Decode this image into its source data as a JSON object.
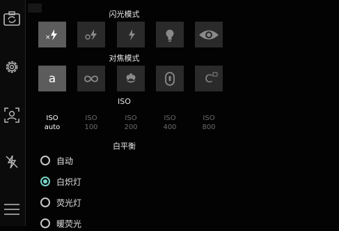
{
  "sidebar": {
    "items": [
      {
        "icon": "switch-camera-icon"
      },
      {
        "icon": "gear-icon"
      },
      {
        "icon": "face-detect-icon"
      },
      {
        "icon": "flash-off-icon"
      },
      {
        "icon": "menu-icon"
      }
    ]
  },
  "flash": {
    "title": "闪光模式",
    "options": [
      {
        "icon": "flash-off-icon",
        "selected": true
      },
      {
        "icon": "flash-auto-icon",
        "selected": false
      },
      {
        "icon": "flash-on-icon",
        "selected": false
      },
      {
        "icon": "torch-bulb-icon",
        "selected": false
      },
      {
        "icon": "red-eye-icon",
        "selected": false
      }
    ]
  },
  "focus": {
    "title": "对焦模式",
    "options": [
      {
        "icon": "auto-focus-icon",
        "text": "a",
        "selected": true
      },
      {
        "icon": "infinity-icon",
        "selected": false
      },
      {
        "icon": "macro-flower-icon",
        "selected": false
      },
      {
        "icon": "focus-lock-icon",
        "selected": false
      },
      {
        "icon": "continuous-focus-icon",
        "text": "C",
        "selected": false
      }
    ]
  },
  "iso": {
    "title": "ISO",
    "options": [
      {
        "line1": "ISO",
        "line2": "auto",
        "selected": true
      },
      {
        "line1": "ISO",
        "line2": "100",
        "selected": false
      },
      {
        "line1": "ISO",
        "line2": "200",
        "selected": false
      },
      {
        "line1": "ISO",
        "line2": "400",
        "selected": false
      },
      {
        "line1": "ISO",
        "line2": "800",
        "selected": false
      }
    ]
  },
  "white_balance": {
    "title": "白平衡",
    "options": [
      {
        "label": "自动",
        "checked": false
      },
      {
        "label": "白炽灯",
        "checked": true
      },
      {
        "label": "荧光灯",
        "checked": false
      },
      {
        "label": "暖荧光",
        "checked": false
      }
    ]
  },
  "colors": {
    "accent": "#7ad6c9",
    "tile": "#2a2a2a",
    "tile_selected": "#5c5c5c"
  }
}
